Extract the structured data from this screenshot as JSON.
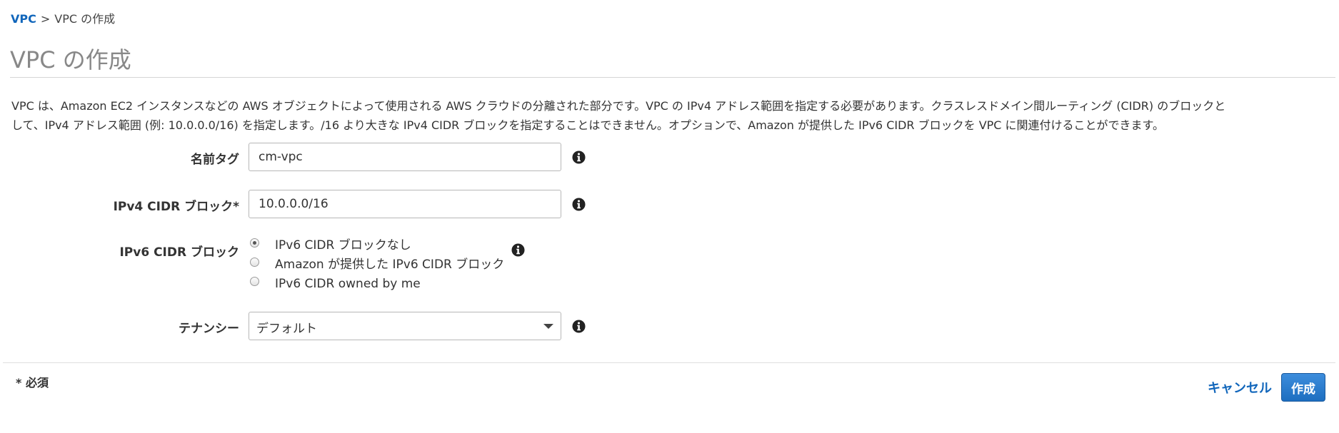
{
  "breadcrumb": {
    "root": "VPC",
    "separator": ">",
    "current": "VPC の作成"
  },
  "page_title": "VPC の作成",
  "description": {
    "line1": "VPC は、Amazon EC2 インスタンスなどの AWS オブジェクトによって使用される AWS クラウドの分離された部分です。VPC の IPv4 アドレス範囲を指定する必要があります。クラスレスドメイン間ルーティング (CIDR) のブロックと",
    "line2": "して、IPv4 アドレス範囲 (例: 10.0.0.0/16) を指定します。/16 より大きな IPv4 CIDR ブロックを指定することはできません。オプションで、Amazon が提供した IPv6 CIDR ブロックを VPC に関連付けることができます。"
  },
  "form": {
    "name_tag": {
      "label": "名前タグ",
      "value": "cm-vpc"
    },
    "ipv4_cidr": {
      "label": "IPv4 CIDR ブロック*",
      "value": "10.0.0.0/16"
    },
    "ipv6_cidr": {
      "label": "IPv6 CIDR ブロック",
      "options": [
        {
          "label": "IPv6 CIDR ブロックなし",
          "checked": true
        },
        {
          "label": "Amazon が提供した IPv6 CIDR ブロック",
          "checked": false
        },
        {
          "label": "IPv6 CIDR owned by me",
          "checked": false
        }
      ]
    },
    "tenancy": {
      "label": "テナンシー",
      "selected": "デフォルト"
    }
  },
  "icons": {
    "info": "info-icon",
    "dropdown": "chevron-down-icon"
  },
  "footer": {
    "required_note": "* 必須",
    "cancel_label": "キャンセル",
    "create_label": "作成"
  },
  "colors": {
    "link": "#1166bb",
    "primary_button": "#2a7dd0",
    "title": "#888888"
  }
}
